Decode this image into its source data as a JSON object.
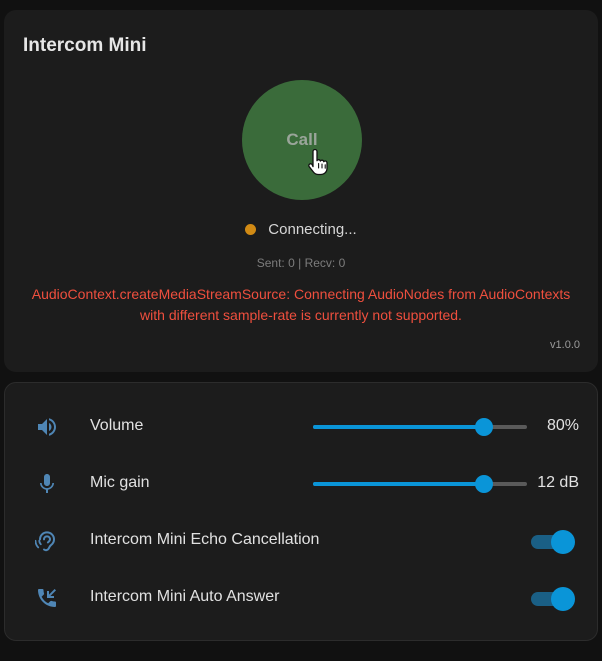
{
  "intercom": {
    "title": "Intercom Mini",
    "call_label": "Call",
    "status_text": "Connecting...",
    "status_color": "#d18a14",
    "stats": "Sent: 0 | Recv: 0",
    "error_line1": "AudioContext.createMediaStreamSource: Connecting AudioNodes from AudioContexts",
    "error_line2": "with different sample-rate is currently not supported.",
    "version": "v1.0.0"
  },
  "controls": {
    "volume": {
      "label": "Volume",
      "value_text": "80%",
      "level": 0.8,
      "icon": "speaker-icon"
    },
    "mic_gain": {
      "label": "Mic gain",
      "value_text": "12 dB",
      "level": 0.8,
      "icon": "microphone-icon"
    },
    "echo": {
      "label": "Intercom Mini Echo Cancellation",
      "on": true,
      "icon": "ear-icon"
    },
    "auto_answer": {
      "label": "Intercom Mini Auto Answer",
      "on": true,
      "icon": "phone-incoming-icon"
    }
  },
  "colors": {
    "accent": "#0a95d8",
    "call_button": "#3a6b3a",
    "error": "#ef4f3e"
  }
}
